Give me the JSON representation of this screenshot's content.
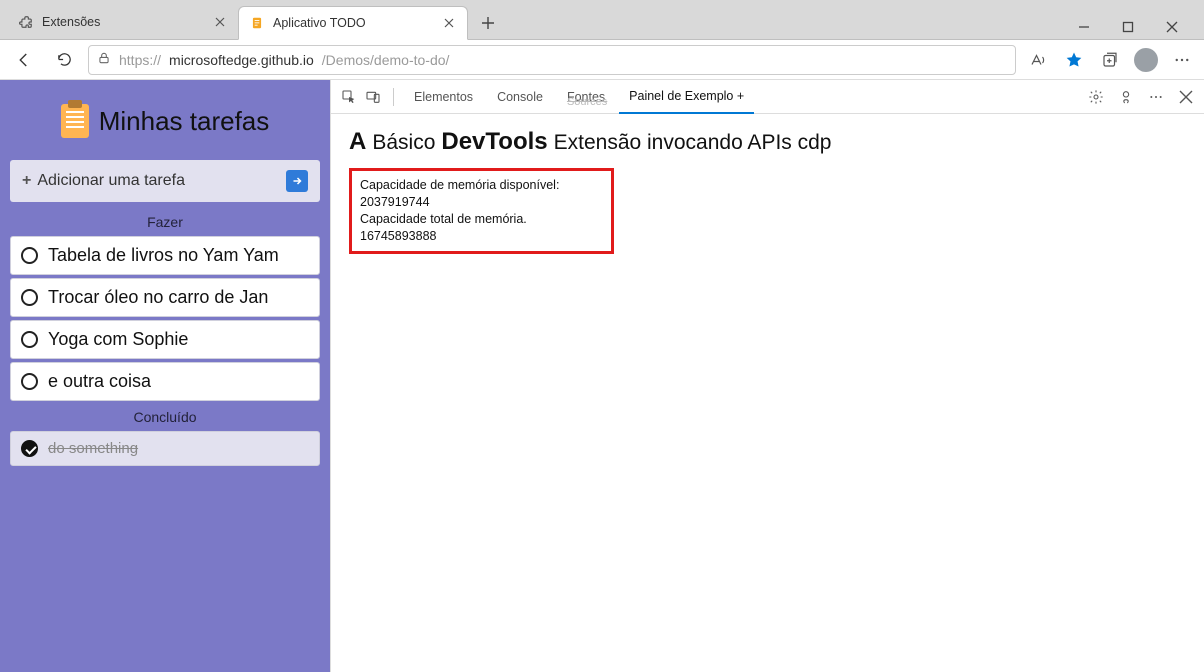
{
  "browser": {
    "tabs": [
      {
        "title": "Extensões"
      },
      {
        "title": "Aplicativo TODO"
      }
    ],
    "url_prefix": "https://",
    "url_host": "microsoftedge.github.io",
    "url_path": "/Demos/demo-to-do/"
  },
  "page": {
    "title": "Minhas tarefas",
    "add_task_label": "Adicionar uma tarefa",
    "sections": {
      "todo_label": "Fazer",
      "done_label": "Concluído"
    },
    "todo_items": [
      "Tabela de livros no Yam Yam",
      "Trocar óleo no carro de Jan",
      "Yoga com Sophie",
      "e outra coisa"
    ],
    "done_items": [
      "do something"
    ]
  },
  "devtools": {
    "tabs": {
      "elements": "Elementos",
      "console": "Console",
      "sources": "Fontes",
      "sources_sub": "Sources",
      "custom_panel": "Painel de Exemplo +"
    },
    "panel": {
      "prefix_bold": "A",
      "basic": "Básico",
      "devtools_word": "DevTools",
      "rest": "Extensão invocando APIs cdp",
      "mem_avail_label": "Capacidade de memória disponível:",
      "mem_avail_value": "2037919744",
      "mem_total_label": "Capacidade total de memória.",
      "mem_total_value": "16745893888"
    }
  }
}
